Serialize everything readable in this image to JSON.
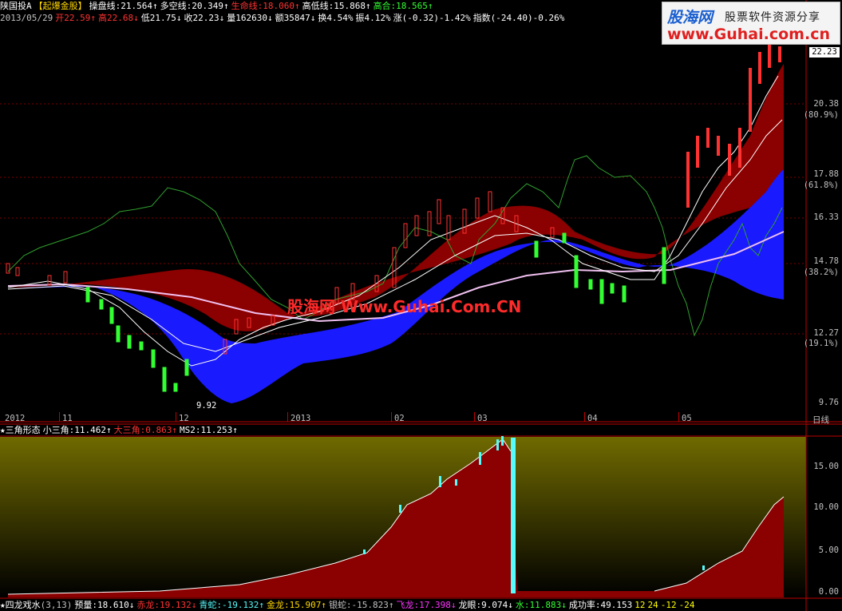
{
  "colors": {
    "background": "#000000",
    "up_red": "#ff3232",
    "down_green": "#54fcfc",
    "ma_white": "#ffffff",
    "band_red": "#8b0000",
    "band_blue": "#1a1aff",
    "line_green": "#2fa02f",
    "label_gold": "#ffd700"
  },
  "main_header": {
    "stock_name": "陕国投A",
    "indicator_name": "【起爆金股】",
    "items": [
      {
        "label": "操盘线:21.564↑",
        "color": "#ffffff"
      },
      {
        "label": "多空线:20.349↑",
        "color": "#ffffff"
      },
      {
        "label": "生命线:18.060↑",
        "color": "#ff3232"
      },
      {
        "label": "高低线:15.868↑",
        "color": "#ffffff"
      },
      {
        "label": "高合:18.565↑",
        "color": "#32ff32"
      }
    ]
  },
  "quote_line": {
    "date": "2013/05/29",
    "open": "开22.59↑",
    "high": "高22.68↓",
    "low": "低21.75↓",
    "close": "收22.23↓",
    "volume": "量162630↓",
    "amount": "额35847↓",
    "turnover": "换4.54%",
    "amplitude": "振4.12%",
    "change": "涨(-0.32)-1.42%",
    "index": "指数(-24.40)-0.26%"
  },
  "watermark": {
    "logo": "股海网",
    "tagline": "股票软件资源分享",
    "url": "www.Guhai.com.cn",
    "center_text": "股海网 Www.Guhai.Com.CN"
  },
  "price_axis": {
    "current_price": "22.23",
    "ticks": [
      {
        "label": "20.38",
        "pct": "(80.9%)"
      },
      {
        "label": "17.88",
        "pct": "(61.8%)"
      },
      {
        "label": "16.33",
        "pct": ""
      },
      {
        "label": "14.78",
        "pct": "(38.2%)"
      },
      {
        "label": "12.27",
        "pct": "(19.1%)"
      },
      {
        "label": "9.76",
        "pct": ""
      }
    ],
    "low_marker": "9.92"
  },
  "date_axis": {
    "ticks": [
      "2012",
      "11",
      "12",
      "2013",
      "02",
      "03",
      "04",
      "05"
    ],
    "period": "日线"
  },
  "sub1": {
    "title": "★三角形态",
    "items": [
      {
        "label": "小三角:11.462↑",
        "color": "#ffffff"
      },
      {
        "label": "大三角:0.863↑",
        "color": "#ff3232"
      },
      {
        "label": "MS2:11.253↑",
        "color": "#ffffff"
      }
    ],
    "y_ticks": [
      "15.00",
      "10.00",
      "5.00",
      "0.00"
    ]
  },
  "sub2": {
    "title": "★四龙戏水",
    "params": "(3,13)",
    "items": [
      {
        "label": "预量:18.610↓",
        "color": "#ffffff"
      },
      {
        "label": "赤龙:19.132↓",
        "color": "#ff3232"
      },
      {
        "label": "青蛇:-19.132↑",
        "color": "#54fcfc"
      },
      {
        "label": "金龙:15.907↑",
        "color": "#ffd700"
      },
      {
        "label": "银蛇:-15.823↑",
        "color": "#c0c0c0"
      },
      {
        "label": "飞龙:17.398↓",
        "color": "#ff32ff"
      },
      {
        "label": "龙眼:9.074↓",
        "color": "#ffffff"
      },
      {
        "label": "水:11.883↓",
        "color": "#32ff32"
      },
      {
        "label": "成功率:49.153",
        "color": "#ffffff"
      },
      {
        "label": "12",
        "color": "#ffff00"
      },
      {
        "label": "24",
        "color": "#ffff00"
      },
      {
        "label": "-12",
        "color": "#ffff00"
      },
      {
        "label": "-24",
        "color": "#ffff00"
      }
    ]
  }
}
